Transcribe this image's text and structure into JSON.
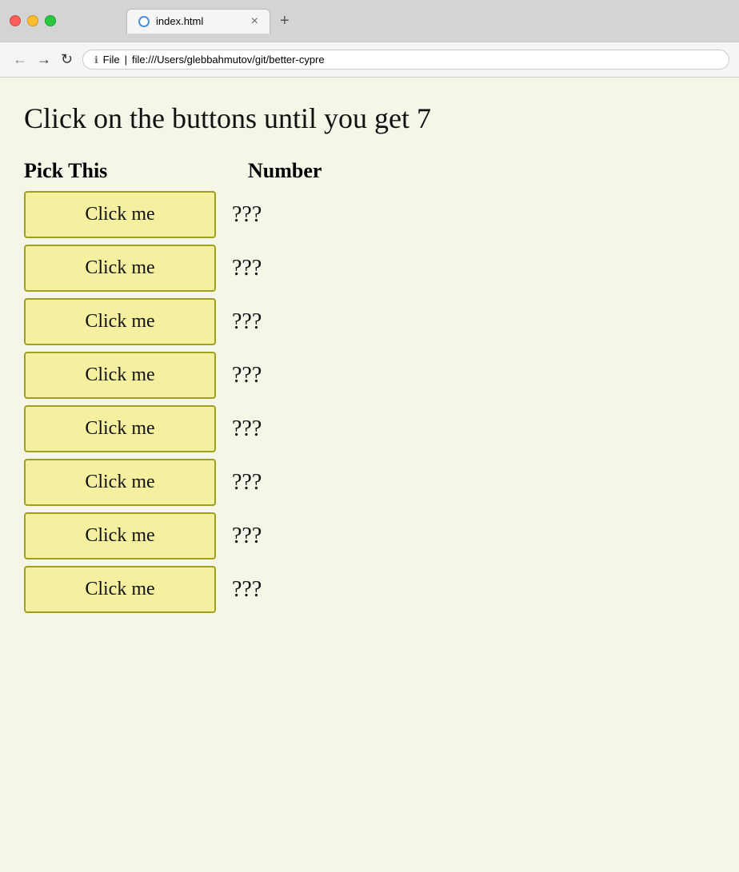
{
  "browser": {
    "tab_label": "index.html",
    "tab_close": "×",
    "tab_new": "+",
    "nav_back": "←",
    "nav_forward": "→",
    "nav_reload": "↻",
    "address_protocol": "File",
    "address_url": "file:///Users/glebbahmutov/git/better-cypre",
    "address_icon": "ℹ"
  },
  "page": {
    "title": "Click on the buttons until you get 7",
    "col_pick": "Pick This",
    "col_number": "Number",
    "buttons": [
      {
        "label": "Click me",
        "value": "???"
      },
      {
        "label": "Click me",
        "value": "???"
      },
      {
        "label": "Click me",
        "value": "???"
      },
      {
        "label": "Click me",
        "value": "???"
      },
      {
        "label": "Click me",
        "value": "???"
      },
      {
        "label": "Click me",
        "value": "???"
      },
      {
        "label": "Click me",
        "value": "???"
      },
      {
        "label": "Click me",
        "value": "???"
      }
    ]
  }
}
